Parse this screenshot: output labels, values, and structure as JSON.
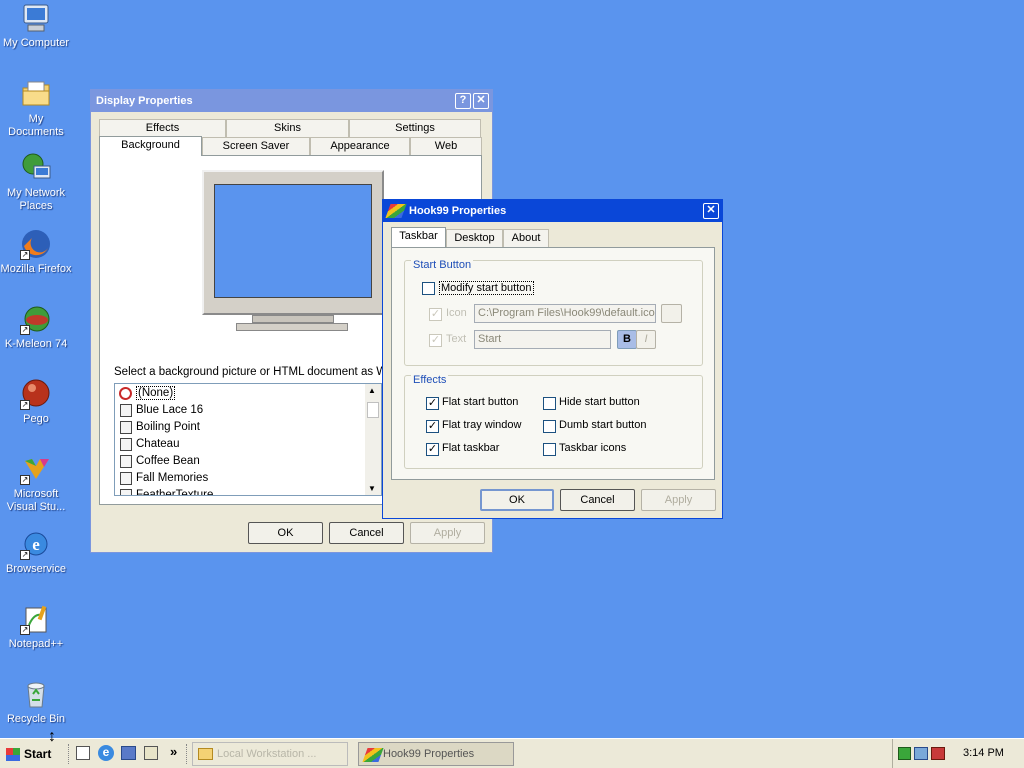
{
  "desktop": {
    "icons": [
      {
        "label": "My Computer",
        "icon": "computer-icon"
      },
      {
        "label": "My Documents",
        "icon": "folder-icon"
      },
      {
        "label": "My Network Places",
        "icon": "network-icon"
      },
      {
        "label": "Mozilla Firefox",
        "icon": "firefox-icon"
      },
      {
        "label": "K-Meleon 74",
        "icon": "kmeleon-icon"
      },
      {
        "label": "Pego",
        "icon": "pego-icon"
      },
      {
        "label": "Microsoft Visual Stu...",
        "icon": "visual-studio-icon"
      },
      {
        "label": "Browservice",
        "icon": "ie-icon"
      },
      {
        "label": "Notepad++",
        "icon": "notepad-icon"
      },
      {
        "label": "Recycle Bin",
        "icon": "recycle-bin-icon"
      }
    ]
  },
  "display_properties": {
    "title": "Display Properties",
    "tabs_row1": [
      "Effects",
      "Skins",
      "Settings"
    ],
    "tabs_row2": [
      "Background",
      "Screen Saver",
      "Appearance",
      "Web"
    ],
    "select_label": "Select a background picture or HTML document as Wall",
    "list_items": [
      "(None)",
      "Blue Lace 16",
      "Boiling Point",
      "Chateau",
      "Coffee Bean",
      "Fall Memories",
      "FeatherTexture"
    ],
    "ok": "OK",
    "cancel": "Cancel",
    "apply": "Apply",
    "help_icon": "?",
    "close_icon": "✕"
  },
  "hook99": {
    "title": "Hook99 Properties",
    "tabs": [
      "Taskbar",
      "Desktop",
      "About"
    ],
    "start_button_group": "Start Button",
    "modify_start_button": "Modify start button",
    "icon_label": "Icon",
    "icon_path": "C:\\Program Files\\Hook99\\default.ico",
    "text_label": "Text",
    "text_value": "Start",
    "bold_label": "B",
    "italic_label": "I",
    "effects_group": "Effects",
    "effects": [
      {
        "label": "Flat start button",
        "checked": true
      },
      {
        "label": "Hide start button",
        "checked": false
      },
      {
        "label": "Flat tray window",
        "checked": true
      },
      {
        "label": "Dumb start button",
        "checked": false
      },
      {
        "label": "Flat taskbar",
        "checked": true
      },
      {
        "label": "Taskbar icons",
        "checked": false
      }
    ],
    "ok": "OK",
    "cancel": "Cancel",
    "apply": "Apply",
    "close_icon": "✕",
    "check_mark": "✓"
  },
  "taskbar": {
    "start_label": "Start",
    "quick_launch_more": "»",
    "tasks": [
      "Local Workstation ...",
      "Hook99 Properties"
    ],
    "clock": "3:14 PM"
  },
  "colors": {
    "desktop": "#5a94ee",
    "active_title": "#0a47d8",
    "inactive_title": "#7a96df",
    "window_face": "#ece9d8"
  }
}
